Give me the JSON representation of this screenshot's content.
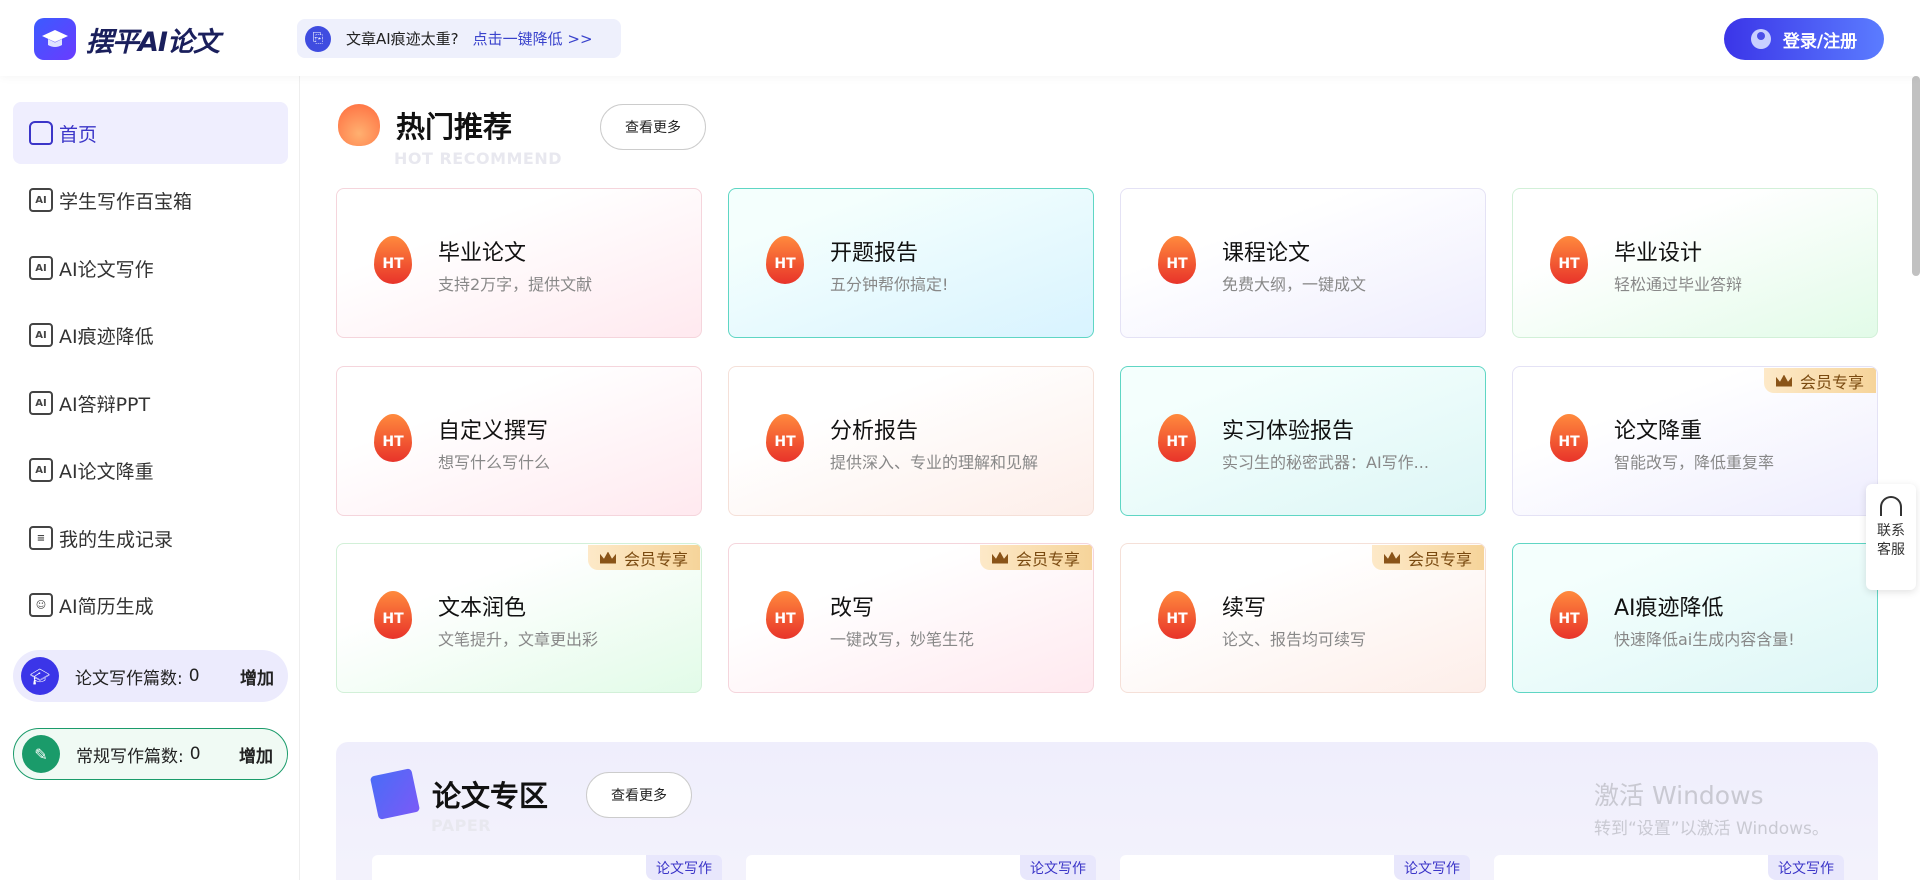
{
  "header": {
    "brand": "摆平AI论文",
    "promo_text": "文章AI痕迹太重?",
    "promo_link": "点击一键降低 >>",
    "login_label": "登录/注册"
  },
  "sidebar": {
    "items": [
      {
        "label": "首页",
        "icon": "home-icon",
        "active": true
      },
      {
        "label": "学生写作百宝箱",
        "icon": "ai-card-icon"
      },
      {
        "label": "AI论文写作",
        "icon": "ai-card-icon"
      },
      {
        "label": "AI痕迹降低",
        "icon": "ai-doc-icon"
      },
      {
        "label": "AI答辩PPT",
        "icon": "ai-doc-icon"
      },
      {
        "label": "AI论文降重",
        "icon": "ai-doc-icon"
      },
      {
        "label": "我的生成记录",
        "icon": "record-icon"
      },
      {
        "label": "AI简历生成",
        "icon": "resume-icon"
      }
    ],
    "quota_paper": {
      "label": "论文写作篇数:",
      "value": "0",
      "add": "增加"
    },
    "quota_general": {
      "label": "常规写作篇数:",
      "value": "0",
      "add": "增加"
    }
  },
  "hot": {
    "title": "热门推荐",
    "subtitle": "HOT RECOMMEND",
    "more": "查看更多",
    "badge_icon": "HT",
    "cards": [
      {
        "title": "毕业论文",
        "desc": "支持2万字，提供文献",
        "style": "pink"
      },
      {
        "title": "开题报告",
        "desc": "五分钟帮你搞定!",
        "style": "blue"
      },
      {
        "title": "课程论文",
        "desc": "免费大纲，一键成文",
        "style": "lav"
      },
      {
        "title": "毕业设计",
        "desc": "轻松通过毕业答辩",
        "style": "green"
      },
      {
        "title": "自定义撰写",
        "desc": "想写什么写什么",
        "style": "pink"
      },
      {
        "title": "分析报告",
        "desc": "提供深入、专业的理解和见解",
        "style": "peach"
      },
      {
        "title": "实习体验报告",
        "desc": "实习生的秘密武器：AI写作...",
        "style": "mint"
      },
      {
        "title": "论文降重",
        "desc": "智能改写，降低重复率",
        "style": "lav",
        "badge": "会员专享"
      },
      {
        "title": "文本润色",
        "desc": "文笔提升，文章更出彩",
        "style": "green",
        "badge": "会员专享"
      },
      {
        "title": "改写",
        "desc": "一键改写，妙笔生花",
        "style": "pink",
        "badge": "会员专享"
      },
      {
        "title": "续写",
        "desc": "论文、报告均可续写",
        "style": "peach",
        "badge": "会员专享"
      },
      {
        "title": "AI痕迹降低",
        "desc": "快速降低ai生成内容含量!",
        "style": "mint"
      }
    ]
  },
  "paper": {
    "title": "论文专区",
    "subtitle": "PAPER",
    "more": "查看更多",
    "tags": [
      "论文写作",
      "论文写作",
      "论文写作",
      "论文写作"
    ]
  },
  "watermark": {
    "line1": "激活 Windows",
    "line2": "转到“设置”以激活 Windows。"
  },
  "service": {
    "label": "联系客服"
  }
}
